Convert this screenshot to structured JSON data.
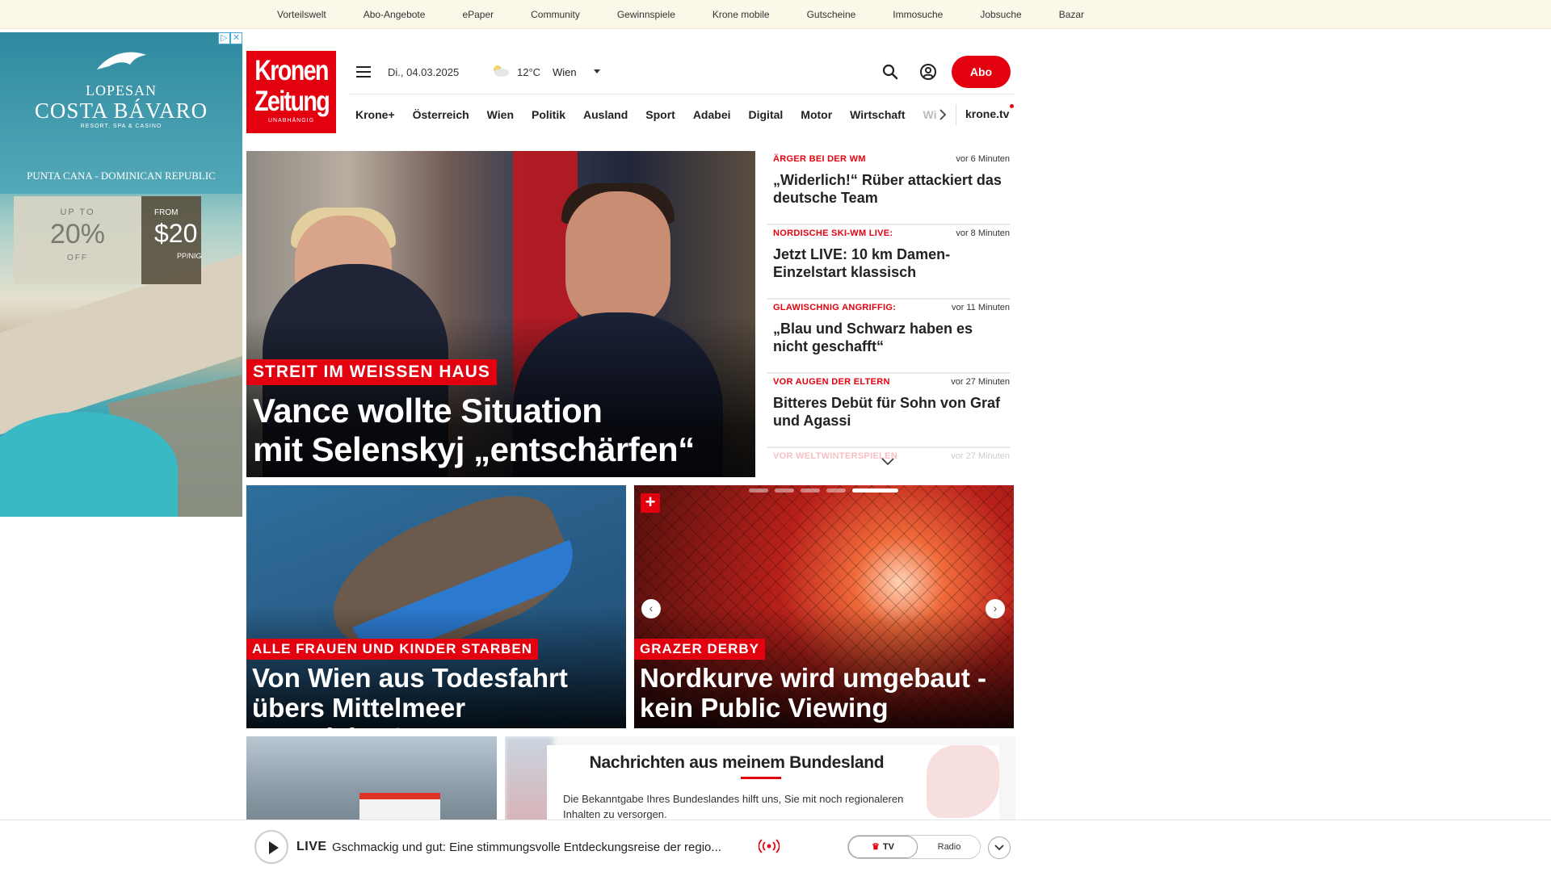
{
  "topbar": {
    "links": [
      "Vorteilswelt",
      "Abo-Angebote",
      "ePaper",
      "Community",
      "Gewinnspiele",
      "Krone mobile",
      "Gutscheine",
      "Immosuche",
      "Jobsuche",
      "Bazar"
    ]
  },
  "ad": {
    "brand_line1": "LOPESAN",
    "brand_line2": "COSTA BÁVARO",
    "brand_line3": "RESORT, SPA & CASINO",
    "location": "PUNTA CANA - DOMINICAN REPUBLIC",
    "up_to": "UP TO",
    "percent": "20%",
    "off": "OFF",
    "from": "FROM",
    "price": "$20",
    "per": "PP/NIG"
  },
  "logo": {
    "word1": "Kronen",
    "word2": "Zeitung",
    "tagline": "UNABHÄNGIG"
  },
  "header": {
    "date": "Di., 04.03.2025",
    "temperature": "12°C",
    "city": "Wien",
    "abo_label": "Abo",
    "weather_icon": "partly-cloudy-icon"
  },
  "nav": {
    "items": [
      "Krone+",
      "Österreich",
      "Wien",
      "Politik",
      "Ausland",
      "Sport",
      "Adabei",
      "Digital",
      "Motor",
      "Wirtschaft",
      "Wiss"
    ],
    "tv_link": "krone.tv"
  },
  "hero": {
    "kicker": "STREIT IM WEISSEN HAUS",
    "headline_line1": "Vance wollte Situation",
    "headline_line2": "mit Selenskyj „entschärfen“"
  },
  "ticker": [
    {
      "kicker": "ÄRGER BEI DER WM",
      "time": "vor 6 Minuten",
      "headline": "„Widerlich!“ Rüber attackiert das deutsche Team"
    },
    {
      "kicker": "NORDISCHE SKI-WM LIVE:",
      "time": "vor 8 Minuten",
      "headline": "Jetzt LIVE: 10 km Damen-Einzelstart klassisch"
    },
    {
      "kicker": "GLAWISCHNIG ANGRIFFIG:",
      "time": "vor 11 Minuten",
      "headline": "„Blau und Schwarz haben es nicht geschafft“"
    },
    {
      "kicker": "VOR AUGEN DER ELTERN",
      "time": "vor 27 Minuten",
      "headline": "Bitteres Debüt für Sohn von Graf und Agassi"
    },
    {
      "kicker": "VOR WELTWINTERSPIELEN",
      "time": "vor 27 Minuten",
      "headline": ""
    }
  ],
  "cards": [
    {
      "kicker": "ALLE FRAUEN UND KINDER STARBEN",
      "headline_line1": "Von Wien aus Todesfahrt",
      "headline_line2": "übers Mittelmeer organisiert?"
    },
    {
      "kicker": "GRAZER DERBY",
      "headline_line1": "Nordkurve wird umgebaut -",
      "headline_line2": "kein Public Viewing",
      "badge": "+"
    }
  ],
  "bundesland": {
    "title": "Nachrichten aus meinem Bundesland",
    "text": "Die Bekanntgabe Ihres Bundeslandes hilft uns, Sie mit noch regionaleren Inhalten zu versorgen."
  },
  "livebar": {
    "live_label": "LIVE",
    "text": "Gschmackig und gut: Eine stimmungsvolle Entdeckungsreise der regio...",
    "tv_label": "TV",
    "radio_label": "Radio"
  },
  "colors": {
    "brand_red": "#e3000f",
    "topbar_bg": "#fbf7e9"
  }
}
